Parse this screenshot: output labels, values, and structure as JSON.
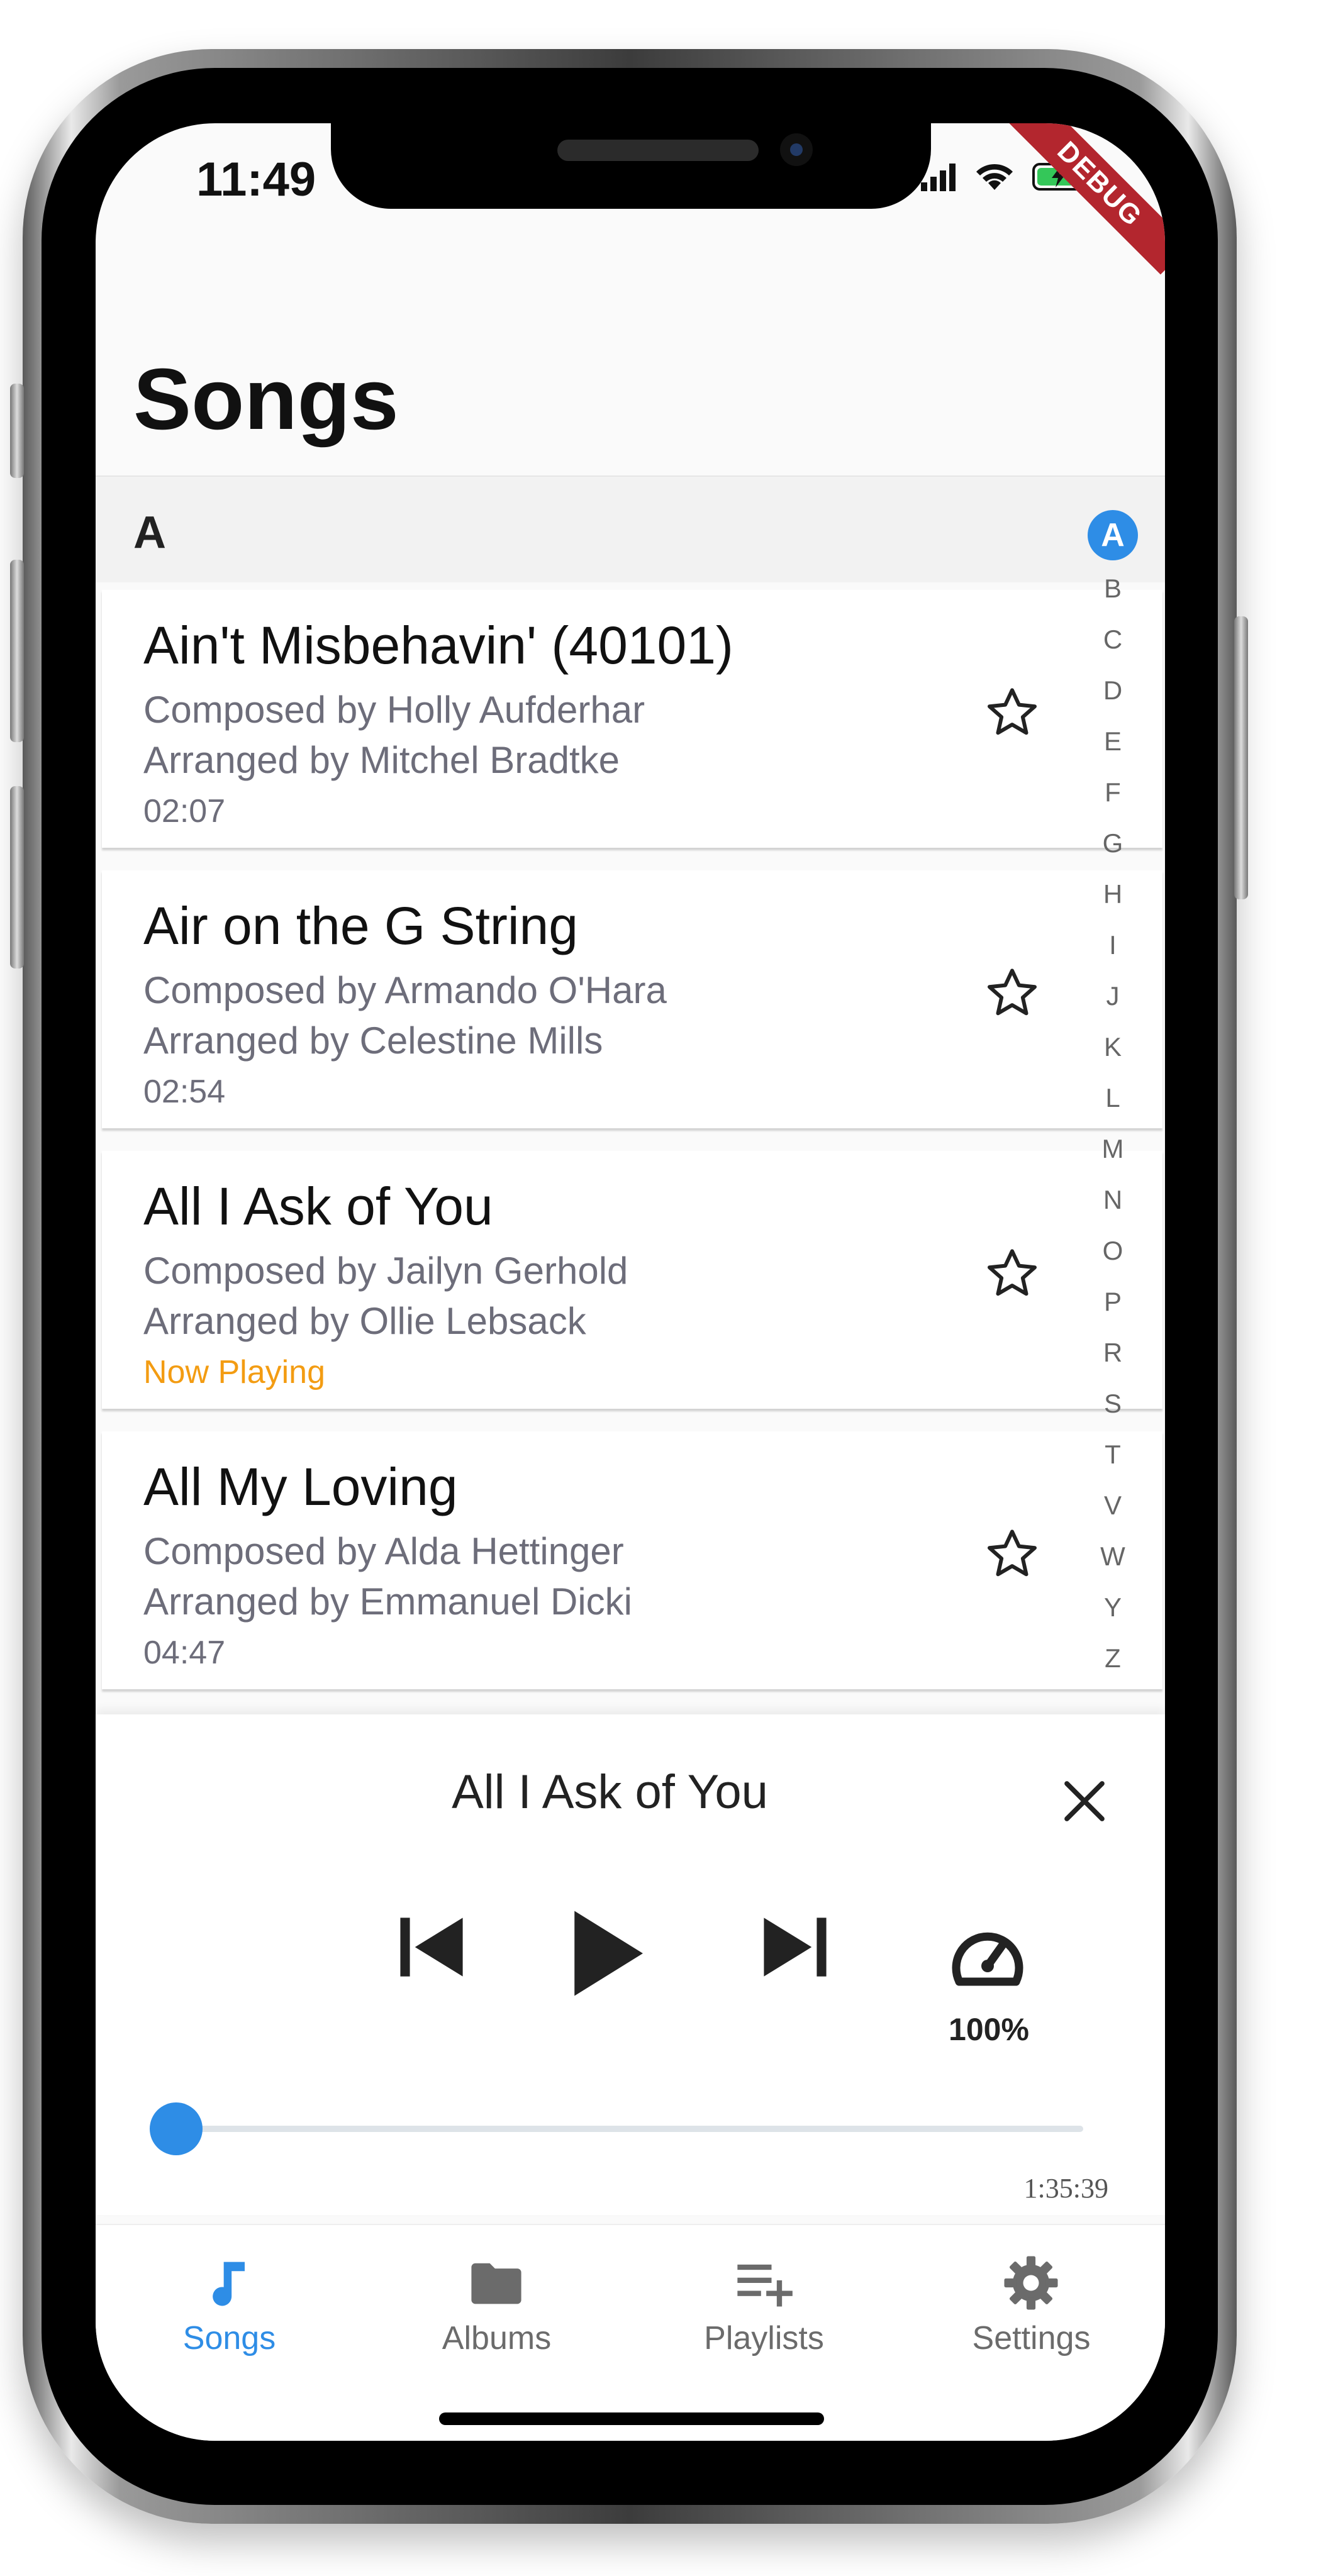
{
  "status_bar": {
    "time": "11:49",
    "debug_label": "DEBUG"
  },
  "header": {
    "title": "Songs"
  },
  "section": {
    "letter": "A"
  },
  "songs": [
    {
      "title": "Ain't Misbehavin' (40101)",
      "composer": "Composed by Holly Aufderhar",
      "arranger": "Arranged by Mitchel Bradtke",
      "meta": "02:07",
      "playing": false
    },
    {
      "title": "Air on the G String",
      "composer": "Composed by Armando O'Hara",
      "arranger": "Arranged by Celestine Mills",
      "meta": "02:54",
      "playing": false
    },
    {
      "title": "All I Ask of You",
      "composer": "Composed by Jailyn Gerhold",
      "arranger": "Arranged by Ollie Lebsack",
      "meta": "Now Playing",
      "playing": true
    },
    {
      "title": "All My Loving",
      "composer": "Composed by Alda Hettinger",
      "arranger": "Arranged by Emmanuel Dicki",
      "meta": "04:47",
      "playing": false
    }
  ],
  "alphabet_index": {
    "active": "A",
    "letters": [
      "B",
      "C",
      "D",
      "E",
      "F",
      "G",
      "H",
      "I",
      "J",
      "K",
      "L",
      "M",
      "N",
      "O",
      "P",
      "R",
      "S",
      "T",
      "V",
      "W",
      "Y",
      "Z"
    ]
  },
  "player": {
    "title": "All I Ask of You",
    "speed": "100%",
    "duration": "1:35:39",
    "progress": 0.0
  },
  "bottom_nav": [
    {
      "label": "Songs",
      "icon": "music-note-icon",
      "active": true
    },
    {
      "label": "Albums",
      "icon": "folder-icon",
      "active": false
    },
    {
      "label": "Playlists",
      "icon": "playlist-add-icon",
      "active": false
    },
    {
      "label": "Settings",
      "icon": "gear-icon",
      "active": false
    }
  ],
  "colors": {
    "accent": "#2e8de6",
    "now_playing": "#f39c12",
    "debug_banner": "#b3262e"
  }
}
